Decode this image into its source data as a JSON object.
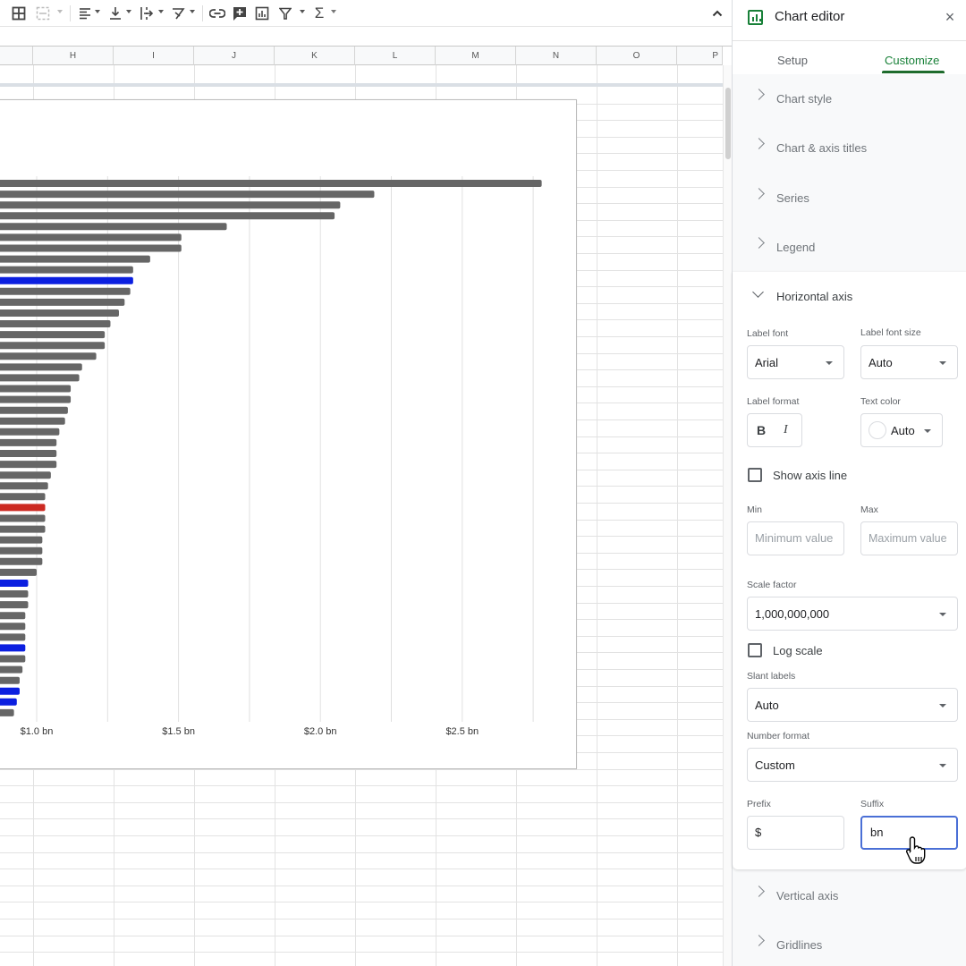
{
  "toolbar": {
    "icons": [
      "borders-icon",
      "merge-cells-icon",
      "horizontal-align-icon",
      "vertical-align-icon",
      "text-wrapping-icon",
      "text-rotation-icon",
      "insert-link-icon",
      "insert-comment-icon",
      "insert-chart-icon",
      "filter-icon",
      "functions-icon",
      "collapse-toolbar-icon"
    ],
    "glyphs": {
      "sigma": "Σ",
      "collapse": "⌃"
    }
  },
  "columns": [
    "H",
    "I",
    "J",
    "K",
    "L",
    "M",
    "N",
    "O",
    "P"
  ],
  "chart_data": {
    "type": "bar",
    "orientation": "horizontal",
    "title": "",
    "xlabel": "",
    "ylabel": "",
    "xlim_visible": [
      0.75,
      2.85
    ],
    "x_ticks": [
      {
        "value": 1.0,
        "label": "$1.0 bn"
      },
      {
        "value": 1.5,
        "label": "$1.5 bn"
      },
      {
        "value": 2.0,
        "label": "$2.0 bn"
      },
      {
        "value": 2.5,
        "label": "$2.5 bn"
      }
    ],
    "minor_gridlines": [
      1.25,
      1.75,
      2.25,
      2.75
    ],
    "grid": true,
    "legend": "none",
    "colors": {
      "default": "#666666",
      "highlight_blue": "#0b1fe0",
      "highlight_red": "#cc2a22"
    },
    "values": [
      2.78,
      2.19,
      2.07,
      2.05,
      1.67,
      1.51,
      1.51,
      1.4,
      1.34,
      1.34,
      1.33,
      1.31,
      1.29,
      1.26,
      1.24,
      1.24,
      1.21,
      1.16,
      1.15,
      1.12,
      1.12,
      1.11,
      1.1,
      1.08,
      1.07,
      1.07,
      1.07,
      1.05,
      1.04,
      1.03,
      1.03,
      1.03,
      1.03,
      1.02,
      1.02,
      1.02,
      1.0,
      0.97,
      0.97,
      0.97,
      0.96,
      0.96,
      0.96,
      0.96,
      0.96,
      0.95,
      0.94,
      0.94,
      0.93,
      0.92
    ],
    "bar_colors": [
      "default",
      "default",
      "default",
      "default",
      "default",
      "default",
      "default",
      "default",
      "default",
      "highlight_blue",
      "default",
      "default",
      "default",
      "default",
      "default",
      "default",
      "default",
      "default",
      "default",
      "default",
      "default",
      "default",
      "default",
      "default",
      "default",
      "default",
      "default",
      "default",
      "default",
      "default",
      "highlight_red",
      "default",
      "default",
      "default",
      "default",
      "default",
      "default",
      "highlight_blue",
      "default",
      "default",
      "default",
      "default",
      "default",
      "highlight_blue",
      "default",
      "default",
      "default",
      "highlight_blue",
      "highlight_blue",
      "default"
    ],
    "units": "US$ billions"
  },
  "panel": {
    "title": "Chart editor",
    "close": "×",
    "tabs": [
      {
        "label": "Setup",
        "active": false
      },
      {
        "label": "Customize",
        "active": true
      }
    ],
    "sections_before": [
      "Chart style",
      "Chart & axis titles",
      "Series",
      "Legend"
    ],
    "horizontal_axis": {
      "title": "Horizontal axis",
      "label_font": {
        "label": "Label font",
        "value": "Arial"
      },
      "label_font_size": {
        "label": "Label font size",
        "value": "Auto"
      },
      "label_format": {
        "label": "Label format",
        "bold": "B",
        "italic": "I"
      },
      "text_color": {
        "label": "Text color",
        "value": "Auto"
      },
      "show_axis_line": {
        "label": "Show axis line",
        "checked": false
      },
      "min": {
        "label": "Min",
        "placeholder": "Minimum value",
        "value": ""
      },
      "max": {
        "label": "Max",
        "placeholder": "Maximum value",
        "value": ""
      },
      "scale_factor": {
        "label": "Scale factor",
        "value": "1,000,000,000"
      },
      "log_scale": {
        "label": "Log scale",
        "checked": false
      },
      "slant_labels": {
        "label": "Slant labels",
        "value": "Auto"
      },
      "number_format": {
        "label": "Number format",
        "value": "Custom"
      },
      "prefix": {
        "label": "Prefix",
        "value": "$"
      },
      "suffix": {
        "label": "Suffix",
        "value": "bn"
      }
    },
    "sections_after": [
      "Vertical axis",
      "Gridlines"
    ]
  }
}
